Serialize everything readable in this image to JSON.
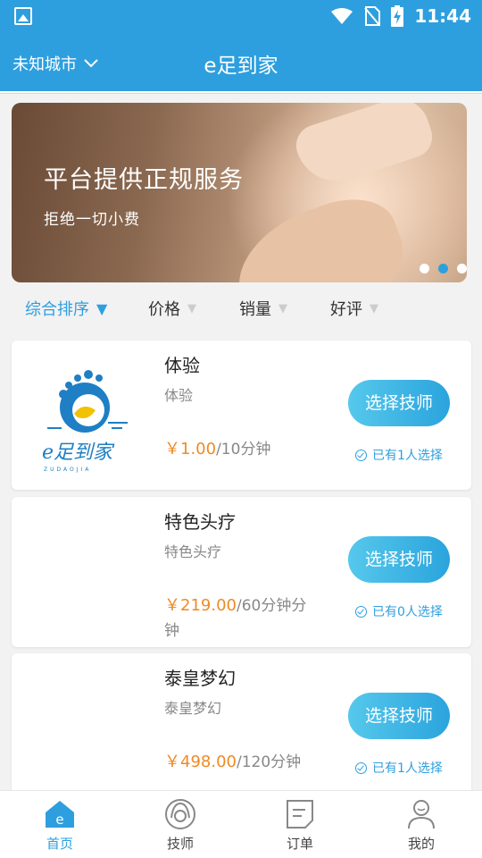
{
  "status_bar": {
    "time": "11:44",
    "icons": [
      "image-icon",
      "wifi-icon",
      "no-sim-icon",
      "battery-charging-icon"
    ]
  },
  "header": {
    "city": "未知城市",
    "title": "e足到家"
  },
  "banner": {
    "headline": "平台提供正规服务",
    "subline": "拒绝一切小费",
    "slide_count": 3,
    "active_slide": 2
  },
  "sort_bar": {
    "items": [
      {
        "label": "综合排序",
        "active": true
      },
      {
        "label": "价格",
        "active": false
      },
      {
        "label": "销量",
        "active": false
      },
      {
        "label": "好评",
        "active": false
      }
    ]
  },
  "services": [
    {
      "name": "体验",
      "desc": "体验",
      "price": "￥1.00",
      "duration": "/10分钟",
      "button": "选择技师",
      "selected_text": "已有1人选择",
      "logo_text": "e足到家",
      "logo_sub": "ZUDAOJIA"
    },
    {
      "name": "特色头疗",
      "desc": "特色头疗",
      "price": "￥219.00",
      "duration": "/60分钟分钟",
      "button": "选择技师",
      "selected_text": "已有0人选择"
    },
    {
      "name": "泰皇梦幻",
      "desc": "泰皇梦幻",
      "price": "￥498.00",
      "duration": "/120分钟",
      "button": "选择技师",
      "selected_text": "已有1人选择"
    }
  ],
  "bottom_nav": {
    "items": [
      {
        "label": "首页",
        "icon": "home-icon",
        "active": true
      },
      {
        "label": "技师",
        "icon": "technician-icon",
        "active": false
      },
      {
        "label": "订单",
        "icon": "order-icon",
        "active": false
      },
      {
        "label": "我的",
        "icon": "profile-icon",
        "active": false
      }
    ]
  },
  "colors": {
    "primary": "#2e9fde",
    "price": "#f08a24",
    "button_gradient_start": "#56c8ec",
    "button_gradient_end": "#2aa4dd"
  }
}
